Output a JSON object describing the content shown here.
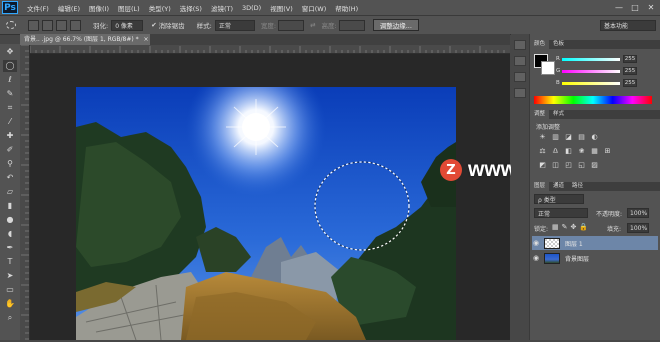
{
  "app": {
    "logo": "Ps"
  },
  "menu": [
    "文件(F)",
    "编辑(E)",
    "图像(I)",
    "图层(L)",
    "类型(Y)",
    "选择(S)",
    "滤镜(T)",
    "3D(D)",
    "视图(V)",
    "窗口(W)",
    "帮助(H)"
  ],
  "window_controls": [
    "—",
    "□",
    "✕"
  ],
  "options": {
    "feather_label": "羽化:",
    "feather_value": "0 像素",
    "antialias_label": "消除锯齿",
    "style_label": "样式:",
    "style_value": "正常",
    "width_label": "宽度:",
    "height_label": "高度:",
    "refine_edge": "调整边缘...",
    "workspace": "基本功能"
  },
  "document": {
    "tab_title": "背景.. .jpg @ 66.7% (图层 1, RGB/8#) *",
    "close": "×"
  },
  "color_panel": {
    "tabs": [
      "颜色",
      "色板"
    ],
    "r": "255",
    "g": "255",
    "b": "255",
    "labels": [
      "R",
      "G",
      "B"
    ]
  },
  "adjust_panel": {
    "tabs": [
      "调整",
      "样式"
    ],
    "title": "添加调整",
    "icons_row1": [
      "☀",
      "▥",
      "◪",
      "▤",
      "◐"
    ],
    "icons_row2": [
      "⚖",
      "♎",
      "◧",
      "❀",
      "▦",
      "⊞"
    ],
    "icons_row3": [
      "◩",
      "◫",
      "◰",
      "◱",
      "▨"
    ]
  },
  "layers_panel": {
    "tabs": [
      "图层",
      "通道",
      "路径"
    ],
    "kind_label": "ρ 类型",
    "blend_mode": "正常",
    "opacity_label": "不透明度:",
    "opacity_value": "100%",
    "lock_label": "锁定:",
    "fill_label": "填充:",
    "fill_value": "100%",
    "layers": [
      {
        "name": "图层 1",
        "selected": true
      },
      {
        "name": "背景图层",
        "selected": false
      }
    ]
  },
  "watermark": {
    "logo": "Z",
    "text": "www.MacZ.com"
  },
  "colors": {
    "accent": "#31a8ff",
    "panel": "#535353",
    "selected_layer": "#6d86a8",
    "sky_top": "#0c3fbd",
    "sky_bottom": "#3d7de0"
  }
}
